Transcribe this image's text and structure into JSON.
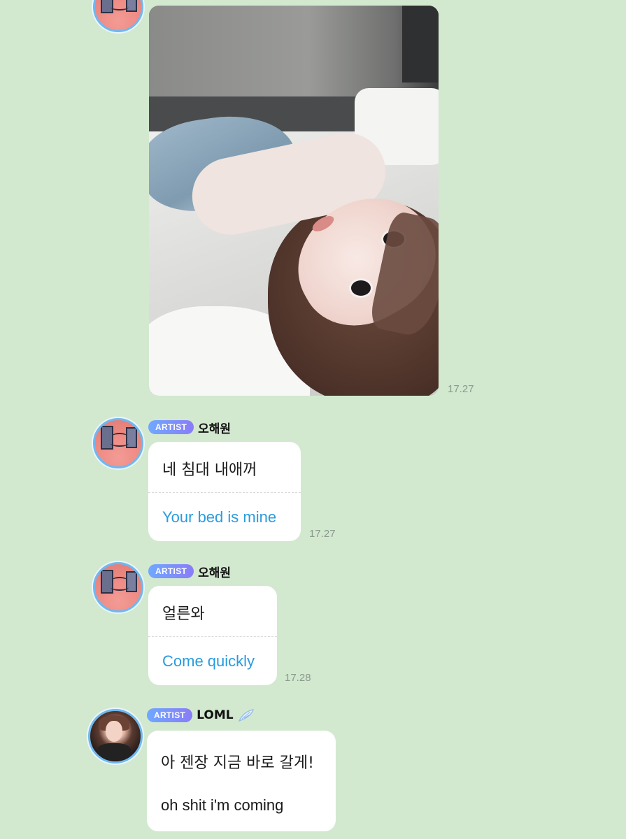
{
  "messages": [
    {
      "type": "photo",
      "time": "17.27"
    },
    {
      "type": "text",
      "badge": "ARTIST",
      "sender": "오해원",
      "original": "네 침대 내애꺼",
      "translation": "Your bed is mine",
      "time": "17.27"
    },
    {
      "type": "text",
      "badge": "ARTIST",
      "sender": "오해원",
      "original": "얼른와",
      "translation": "Come quickly",
      "time": "17.28"
    },
    {
      "type": "text",
      "badge": "ARTIST",
      "sender": "LOML",
      "sender_icon": "wing-icon",
      "original": "아 젠장 지금 바로 갈게!",
      "translation": "oh shit i'm coming"
    }
  ],
  "colors": {
    "background": "#d2e9d0",
    "bubble": "#ffffff",
    "translation_text": "#2a9bdd",
    "badge_gradient_start": "#6fa8ff",
    "badge_gradient_end": "#8a7cf8",
    "avatar_ring": "#6fb8ef",
    "timestamp": "#8b9a8a"
  }
}
